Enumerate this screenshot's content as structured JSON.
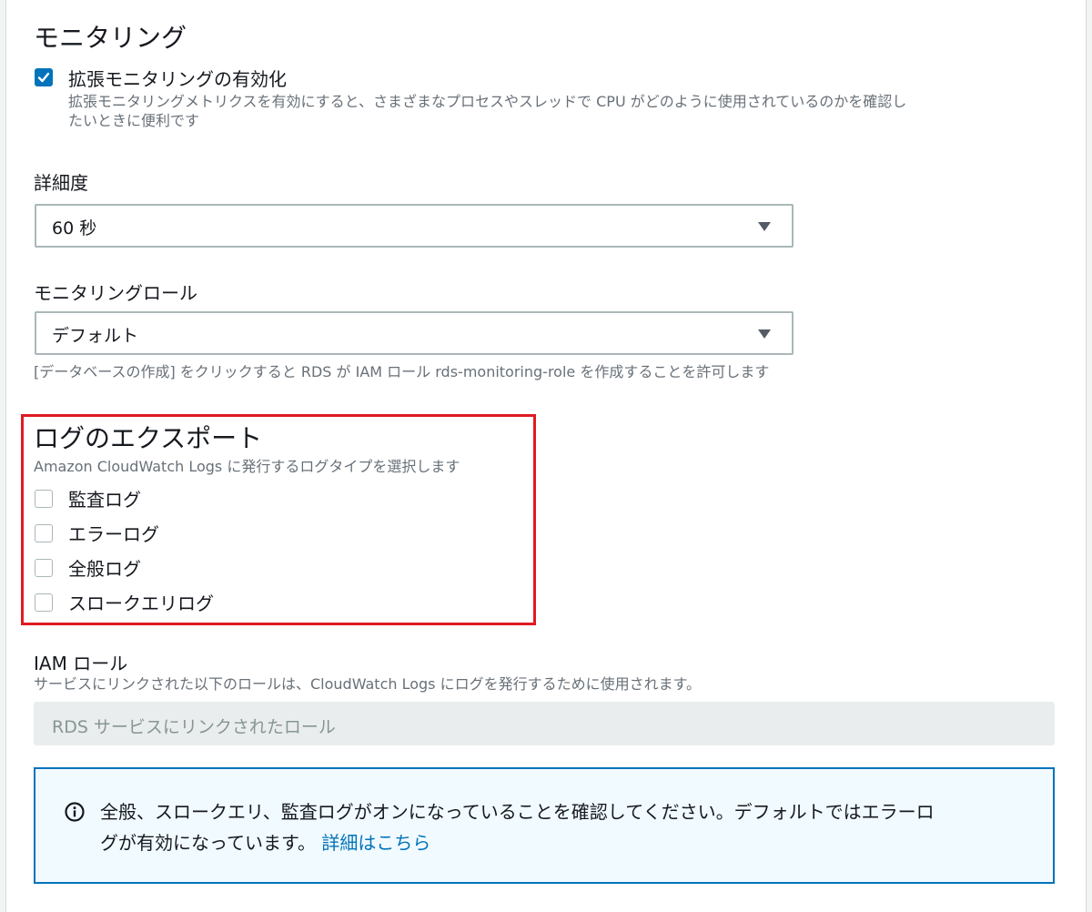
{
  "monitoring": {
    "title": "モニタリング",
    "enhanced_label": "拡張モニタリングの有効化",
    "enhanced_desc": "拡張モニタリングメトリクスを有効にすると、さまざまなプロセスやスレッドで CPU がどのように使用されているのかを確認し",
    "enhanced_desc_2": "たいときに便利です",
    "granularity_label": "詳細度",
    "granularity_value": "60 秒",
    "role_label": "モニタリングロール",
    "role_value": "デフォルト",
    "role_hint": "[データベースの作成] をクリックすると RDS が IAM ロール rds-monitoring-role を作成することを許可します"
  },
  "log_export": {
    "title": "ログのエクスポート",
    "desc": "Amazon CloudWatch Logs に発行するログタイプを選択します",
    "items": [
      {
        "label": "監査ログ",
        "checked": false
      },
      {
        "label": "エラーログ",
        "checked": false
      },
      {
        "label": "全般ログ",
        "checked": false
      },
      {
        "label": "スロークエリログ",
        "checked": false
      }
    ]
  },
  "iam_role": {
    "label": "IAM ロール",
    "desc": "サービスにリンクされた以下のロールは、CloudWatch Logs にログを発行するために使用されます。",
    "value": "RDS サービスにリンクされたロール"
  },
  "info": {
    "text": "全般、スロークエリ、監査ログがオンになっていることを確認してください。デフォルトではエラーロ",
    "text_2": "グが有効になっています。 ",
    "link": "詳細はこちら",
    "icon": "info-icon"
  },
  "colors": {
    "accent": "#0073bb",
    "highlight": "#e01b22"
  }
}
